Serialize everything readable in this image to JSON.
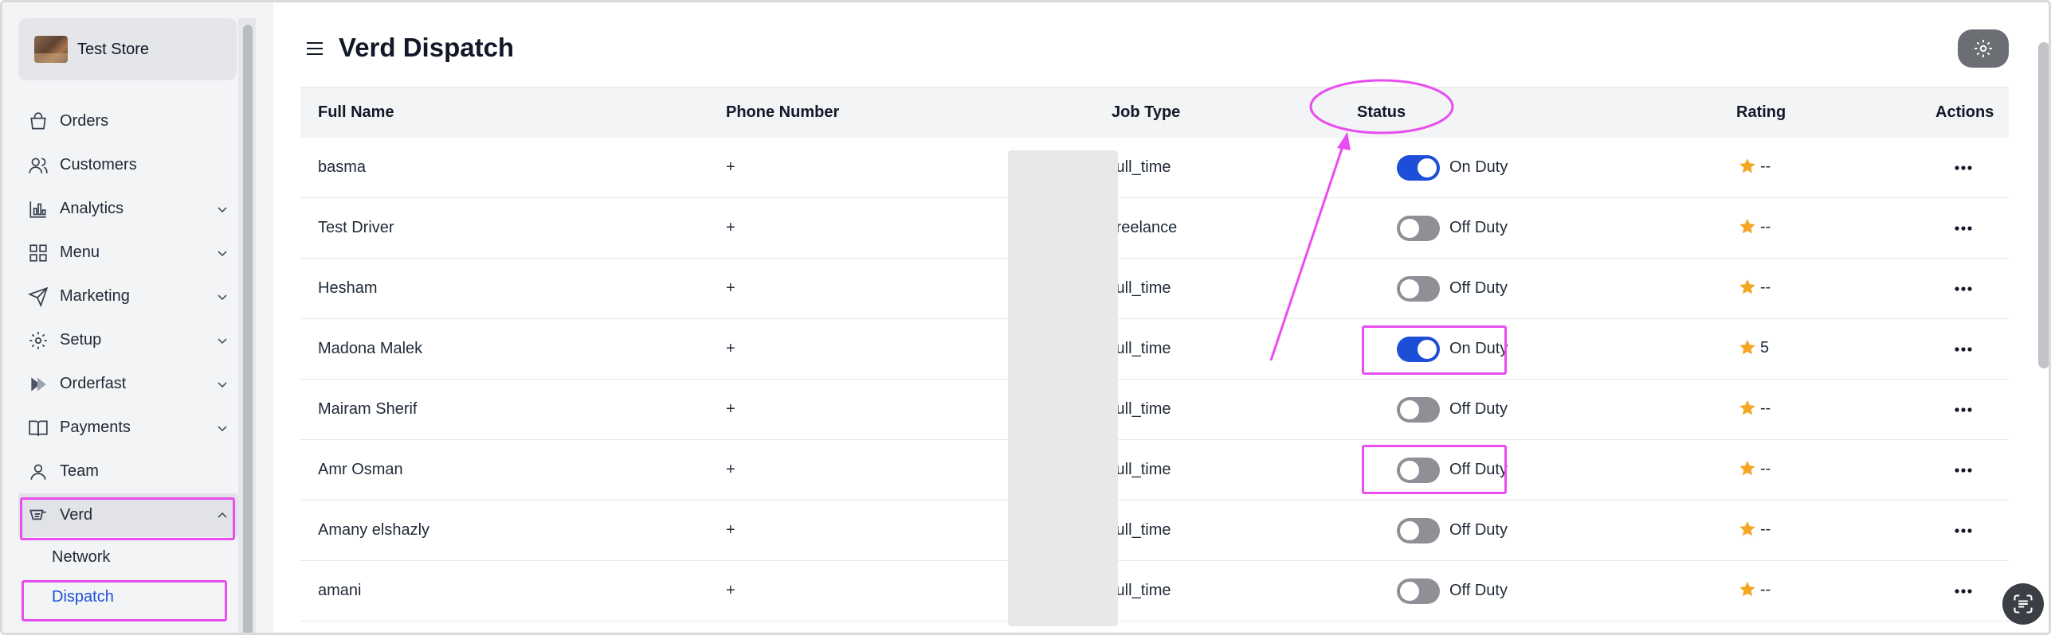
{
  "store": {
    "name": "Test Store"
  },
  "sidebar": {
    "items": [
      {
        "label": "Orders",
        "icon": "shopping-bag-icon",
        "has_chevron": false
      },
      {
        "label": "Customers",
        "icon": "users-icon",
        "has_chevron": false
      },
      {
        "label": "Analytics",
        "icon": "bar-chart-icon",
        "has_chevron": true
      },
      {
        "label": "Menu",
        "icon": "grid-icon",
        "has_chevron": true
      },
      {
        "label": "Marketing",
        "icon": "send-icon",
        "has_chevron": true
      },
      {
        "label": "Setup",
        "icon": "gear-icon",
        "has_chevron": true
      },
      {
        "label": "Orderfast",
        "icon": "orderfast-icon",
        "has_chevron": true
      },
      {
        "label": "Payments",
        "icon": "book-icon",
        "has_chevron": true
      },
      {
        "label": "Team",
        "icon": "user-icon",
        "has_chevron": false
      },
      {
        "label": "Verd",
        "icon": "verd-icon",
        "has_chevron": true,
        "expanded": true
      }
    ],
    "subitems": [
      {
        "label": "Network"
      },
      {
        "label": "Dispatch",
        "active": true
      }
    ]
  },
  "header": {
    "title": "Verd Dispatch"
  },
  "table": {
    "columns": [
      "Full Name",
      "Phone Number",
      "Job Type",
      "Status",
      "Rating",
      "Actions"
    ],
    "rows": [
      {
        "name": "basma",
        "phone": "+",
        "job_type": "full_time",
        "on": true,
        "status": "On Duty",
        "rating": "--"
      },
      {
        "name": "Test Driver",
        "phone": "+",
        "job_type": "freelance",
        "on": false,
        "status": "Off Duty",
        "rating": "--"
      },
      {
        "name": "Hesham",
        "phone": "+",
        "job_type": "full_time",
        "on": false,
        "status": "Off Duty",
        "rating": "--"
      },
      {
        "name": "Madona Malek",
        "phone": "+",
        "job_type": "full_time",
        "on": true,
        "status": "On Duty",
        "rating": "5"
      },
      {
        "name": "Mairam Sherif",
        "phone": "+",
        "job_type": "full_time",
        "on": false,
        "status": "Off Duty",
        "rating": "--"
      },
      {
        "name": "Amr Osman",
        "phone": "+",
        "job_type": "full_time",
        "on": false,
        "status": "Off Duty",
        "rating": "--"
      },
      {
        "name": "Amany elshazly",
        "phone": "+",
        "job_type": "full_time",
        "on": false,
        "status": "Off Duty",
        "rating": "--"
      },
      {
        "name": "amani",
        "phone": "+",
        "job_type": "full_time",
        "on": false,
        "status": "Off Duty",
        "rating": "--"
      }
    ]
  },
  "colors": {
    "accent": "#1d4ed8",
    "toggle_off": "#8e9095",
    "annotation": "#e94df0",
    "star": "#f5a623"
  }
}
